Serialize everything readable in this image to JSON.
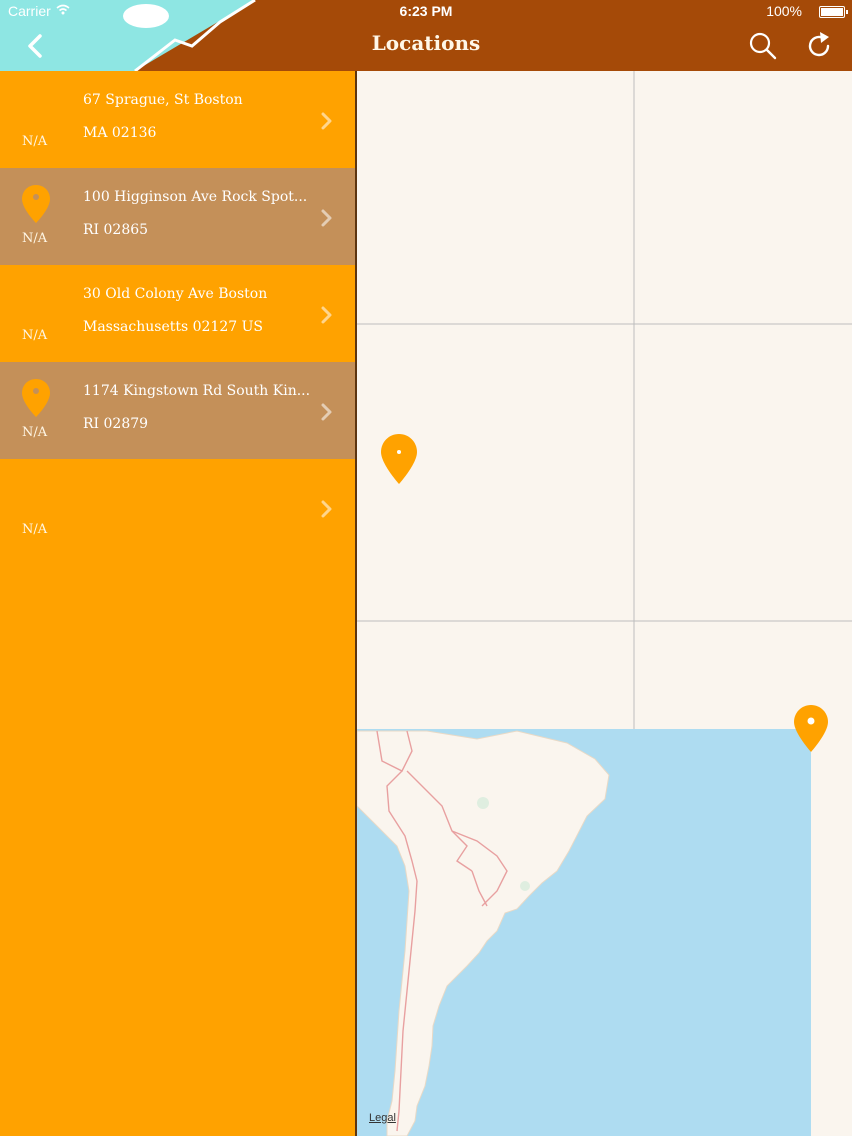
{
  "status_bar": {
    "carrier": "Carrier",
    "time": "6:23 PM",
    "battery": "100%"
  },
  "nav": {
    "title": "Locations",
    "back_icon": "chevron-left-icon",
    "search_icon": "search-icon",
    "refresh_icon": "refresh-icon"
  },
  "colors": {
    "nav_bar": "#a54a08",
    "list_bg": "#ffa200",
    "row_alt": "#c49059",
    "pin": "#ffa200",
    "water": "#aedcf1",
    "land": "#faf5ee"
  },
  "locations": [
    {
      "line1": "67 Sprague, St Boston",
      "line2": "MA 02136",
      "distance": "N/A",
      "has_pin": false
    },
    {
      "line1": "100 Higginson Ave Rock Spot...",
      "line2": "RI 02865",
      "distance": "N/A",
      "has_pin": true
    },
    {
      "line1": "30 Old Colony Ave Boston",
      "line2": "Massachusetts 02127 US",
      "distance": "N/A",
      "has_pin": false
    },
    {
      "line1": "1174 Kingstown Rd South Kin...",
      "line2": "RI 02879",
      "distance": "N/A",
      "has_pin": true
    },
    {
      "line1": "",
      "line2": "",
      "distance": "N/A",
      "has_pin": false
    }
  ],
  "map": {
    "legal": "Legal"
  }
}
